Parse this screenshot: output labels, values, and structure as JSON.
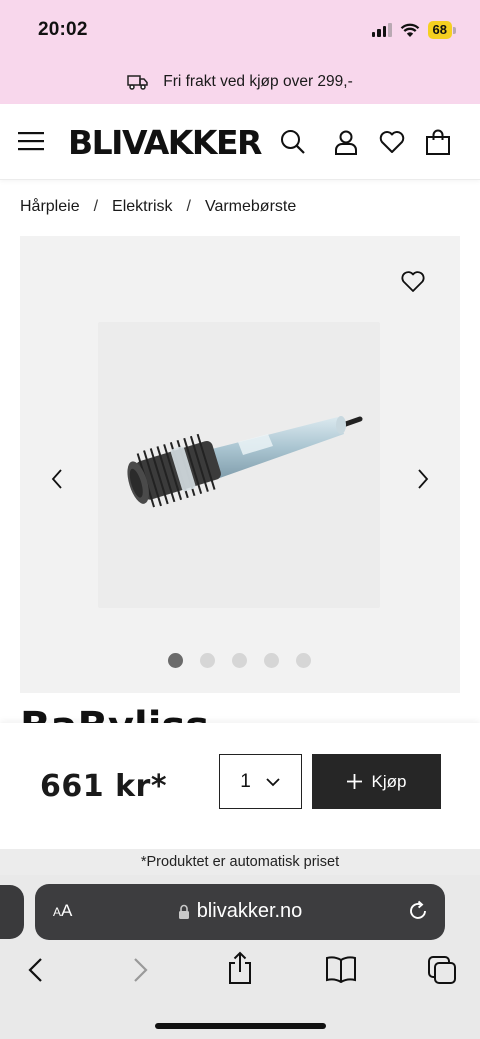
{
  "status_bar": {
    "time": "20:02",
    "battery": "68"
  },
  "promo": {
    "text": "Fri frakt ved kjøp over 299,-"
  },
  "header": {
    "logo": "BLIVAKKER"
  },
  "breadcrumb": {
    "items": [
      "Hårpleie",
      "Elektrisk",
      "Varmebørste"
    ],
    "separator": "/"
  },
  "gallery": {
    "slide_count": 5,
    "active_slide": 1
  },
  "product": {
    "title_peek": "BaByliss"
  },
  "buy_bar": {
    "price": "661 kr*",
    "quantity": "1",
    "buy_label": "Kjøp"
  },
  "auto_price_note": "*Produktet er automatisk priset",
  "browser": {
    "aa_label_small": "A",
    "aa_label_large": "A",
    "url": "blivakker.no"
  },
  "colors": {
    "promo_bg": "#f8d7ec",
    "buy_button": "#262626",
    "battery": "#f5d020"
  },
  "icons": [
    "truck-icon",
    "menu-icon",
    "search-icon",
    "account-icon",
    "wishlist-heart-icon",
    "cart-bag-icon",
    "favorite-heart-icon",
    "chevron-left-icon",
    "chevron-right-icon",
    "chevron-down-icon",
    "plus-icon",
    "lock-icon",
    "reload-icon",
    "back-icon",
    "forward-icon",
    "share-icon",
    "bookmarks-icon",
    "tabs-icon"
  ]
}
